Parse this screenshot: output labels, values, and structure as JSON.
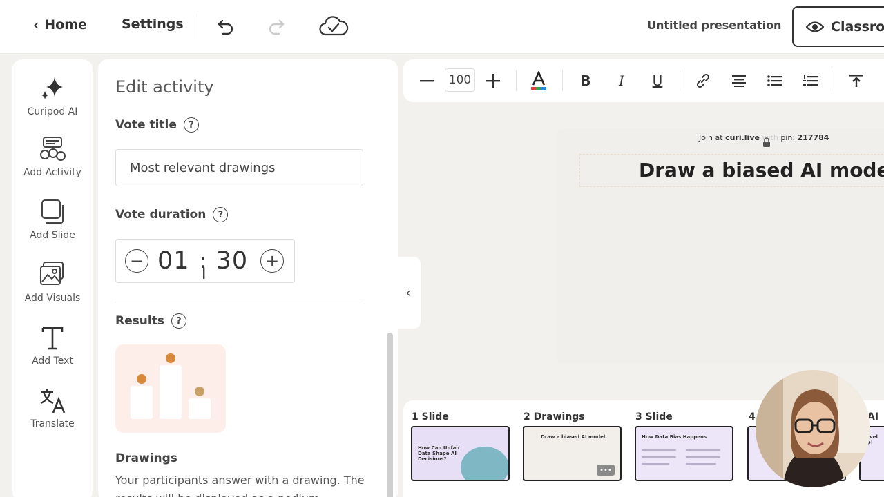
{
  "topbar": {
    "home_label": "Home",
    "settings_label": "Settings",
    "presentation_title": "Untitled presentation",
    "classroom_label": "Classro"
  },
  "rail": {
    "items": [
      {
        "label": "Curipod AI",
        "icon": "sparkle-icon"
      },
      {
        "label": "Add Activity",
        "icon": "activity-icon"
      },
      {
        "label": "Add Slide",
        "icon": "slides-icon"
      },
      {
        "label": "Add Visuals",
        "icon": "image-icon"
      },
      {
        "label": "Add Text",
        "icon": "text-icon"
      },
      {
        "label": "Translate",
        "icon": "translate-icon"
      }
    ]
  },
  "panel": {
    "title": "Edit activity",
    "vote_title_label": "Vote title",
    "vote_title_value": "Most relevant drawings",
    "vote_duration_label": "Vote duration",
    "duration_minutes": "01",
    "duration_separator": ":",
    "duration_seconds": "30",
    "results_label": "Results",
    "drawings_title": "Drawings",
    "drawings_desc": "Your participants answer with a drawing. The results will be displayed as a podium"
  },
  "format_toolbar": {
    "zoom": "100"
  },
  "slide": {
    "join_prefix": "Join at",
    "join_site": "curi.live",
    "join_with": "with",
    "join_pin_label": "pin:",
    "join_pin": "217784",
    "title": "Draw a biased AI model."
  },
  "filmstrip": {
    "thumbs": [
      {
        "label": "1 Slide",
        "mini_title": "How Can Unfair Data Shape AI Decisions?"
      },
      {
        "label": "2 Drawings",
        "mini_title": "Draw a biased AI model."
      },
      {
        "label": "3 Slide",
        "mini_title": "How Data Bias Happens"
      },
      {
        "label": "4",
        "mini_title": ""
      },
      {
        "label": "AI",
        "mini_title": "Level Up!"
      }
    ],
    "more_label": "•••"
  },
  "colors": {
    "accent_purple": "#e6dff6",
    "results_bg": "#fdeee9"
  }
}
